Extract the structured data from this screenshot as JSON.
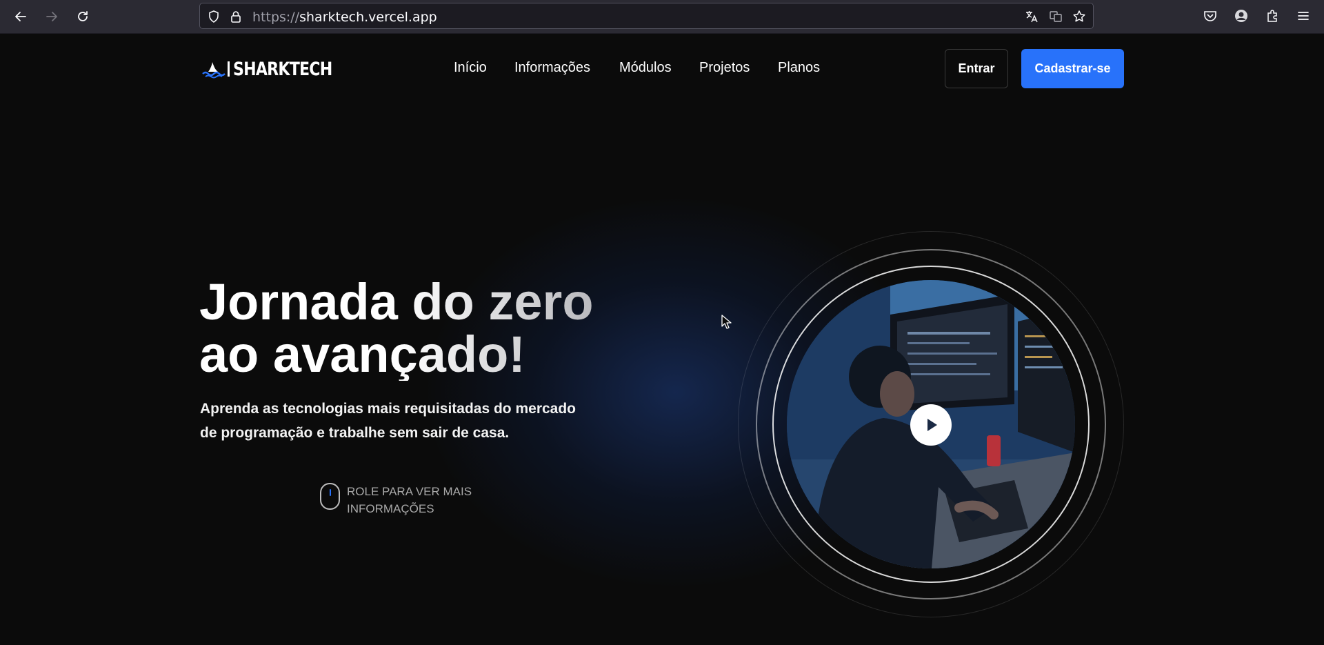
{
  "browser": {
    "url_scheme": "https://",
    "url_host": "sharktech.vercel.app"
  },
  "brand": {
    "name": "SHARKTECH",
    "accent": "#2872fa"
  },
  "nav": {
    "items": [
      {
        "label": "Início"
      },
      {
        "label": "Informações"
      },
      {
        "label": "Módulos"
      },
      {
        "label": "Projetos"
      },
      {
        "label": "Planos"
      }
    ]
  },
  "auth": {
    "login_label": "Entrar",
    "signup_label": "Cadastrar-se"
  },
  "hero": {
    "title_line1": "Jornada do zero",
    "title_line2": "ao avançado!",
    "subtitle_line1": "Aprenda as tecnologias mais requisitadas do mercado",
    "subtitle_line2": "de programação e trabalhe sem sair de casa.",
    "scroll_line1": "ROLE PARA VER MAIS",
    "scroll_line2": "INFORMAÇÕES"
  }
}
